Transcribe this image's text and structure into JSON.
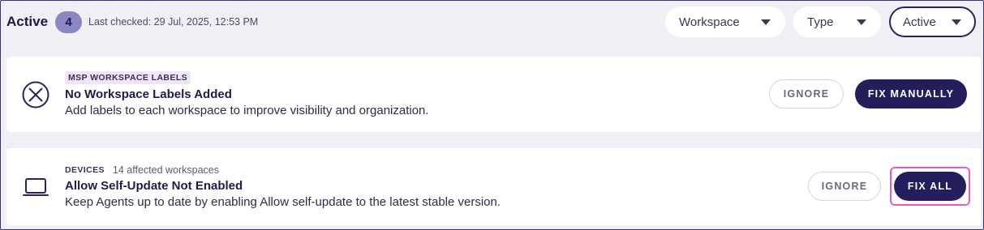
{
  "header": {
    "title": "Active",
    "count": "4",
    "last_checked": "Last checked: 29 Jul, 2025, 12:53 PM"
  },
  "filters": {
    "workspace": "Workspace",
    "type": "Type",
    "status": "Active"
  },
  "cards": [
    {
      "icon": "circle-x-icon",
      "category": "MSP WORKSPACE LABELS",
      "affected": "",
      "title": "No Workspace Labels Added",
      "description": "Add labels to each workspace to improve visibility and organization.",
      "ignore_label": "IGNORE",
      "action_label": "FIX MANUALLY"
    },
    {
      "icon": "laptop-icon",
      "category": "DEVICES",
      "affected": "14 affected workspaces",
      "title": "Allow Self-Update Not Enabled",
      "description": "Keep Agents up to date by enabling Allow self-update to the latest stable version.",
      "ignore_label": "IGNORE",
      "action_label": "FIX ALL"
    }
  ],
  "colors": {
    "primary": "#241f5c",
    "badge": "#8b86c4",
    "highlight": "#e65bc7",
    "background": "#efeff5"
  }
}
